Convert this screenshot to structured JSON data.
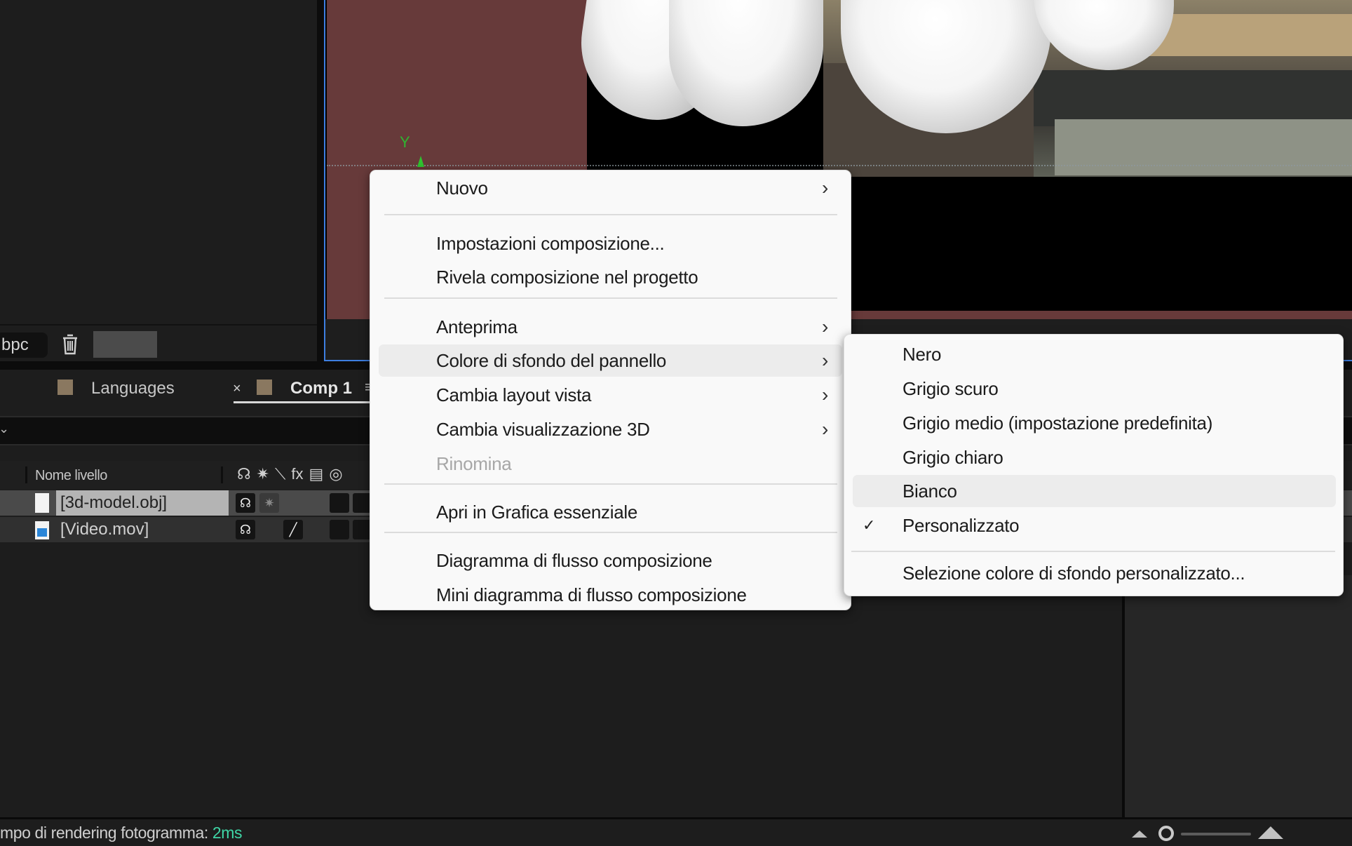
{
  "project_panel": {
    "bit_depth_label": "bpc",
    "trash_icon": "trash-icon"
  },
  "viewer": {
    "axis_label": "Y",
    "background_color": "#673a3a"
  },
  "timeline": {
    "tabs": [
      {
        "label": "Languages",
        "active": false
      },
      {
        "label": "Comp 1",
        "active": true
      }
    ],
    "close_glyph": "×",
    "tab_menu_glyph": "≡",
    "column_header": "Nome livello",
    "column_icons": [
      "☊",
      "✷",
      "⟍",
      "fx",
      "▤",
      "◎"
    ],
    "layers": [
      {
        "name": "[3d-model.obj]",
        "type": "3d-object",
        "selected": true
      },
      {
        "name": "[Video.mov]",
        "type": "video",
        "selected": false
      }
    ]
  },
  "status_bar": {
    "label": "mpo di rendering fotogramma:",
    "value": "2ms"
  },
  "context_menu": {
    "items": [
      {
        "label": "Nuovo",
        "submenu": true
      },
      {
        "label": "Impostazioni composizione...",
        "submenu": false
      },
      {
        "label": "Rivela composizione nel progetto",
        "submenu": false
      },
      {
        "label": "Anteprima",
        "submenu": true
      },
      {
        "label": "Colore di sfondo del pannello",
        "submenu": true,
        "highlighted": true
      },
      {
        "label": "Cambia layout vista",
        "submenu": true
      },
      {
        "label": "Cambia visualizzazione 3D",
        "submenu": true
      },
      {
        "label": "Rinomina",
        "submenu": false,
        "disabled": true
      },
      {
        "label": "Apri in Grafica essenziale",
        "submenu": false
      },
      {
        "label": "Diagramma di flusso composizione",
        "submenu": false
      },
      {
        "label": "Mini diagramma di flusso composizione",
        "submenu": false
      }
    ],
    "arrow_glyph": "›"
  },
  "background_submenu": {
    "items": [
      {
        "label": "Nero",
        "checked": false
      },
      {
        "label": "Grigio scuro",
        "checked": false
      },
      {
        "label": "Grigio medio (impostazione predefinita)",
        "checked": false
      },
      {
        "label": "Grigio chiaro",
        "checked": false
      },
      {
        "label": "Bianco",
        "checked": false,
        "highlighted": true
      },
      {
        "label": "Personalizzato",
        "checked": true
      },
      {
        "label": "Selezione colore di sfondo personalizzato...",
        "checked": false
      }
    ],
    "check_glyph": "✓"
  }
}
